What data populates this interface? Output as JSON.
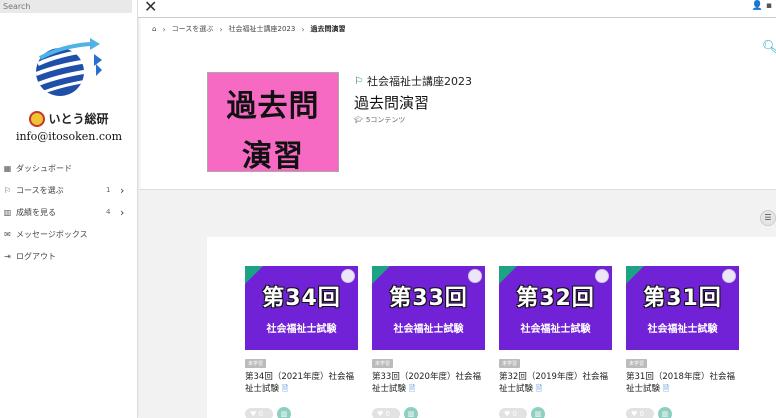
{
  "sidebar": {
    "search_placeholder": "Search",
    "brand_name": "いとう総研",
    "email": "info@itosoken.com",
    "items": [
      {
        "label": "ダッシュボード",
        "icon": "grid-icon",
        "glyph": "▦",
        "count": "",
        "chevron": ""
      },
      {
        "label": "コースを選ぶ",
        "icon": "flag-icon",
        "glyph": "⚐",
        "count": "1",
        "chevron": "›"
      },
      {
        "label": "成績を見る",
        "icon": "chart-icon",
        "glyph": "▥",
        "count": "4",
        "chevron": "›"
      },
      {
        "label": "メッセージボックス",
        "icon": "message-icon",
        "glyph": "✉",
        "count": "",
        "chevron": ""
      },
      {
        "label": "ログアウト",
        "icon": "logout-icon",
        "glyph": "⇥",
        "count": "",
        "chevron": ""
      }
    ]
  },
  "topbar": {
    "close_glyph": "✕",
    "user_glyph": "👤 ▪"
  },
  "breadcrumb": {
    "home_glyph": "⌂",
    "items": [
      "コースを選ぶ",
      "社会福祉士講座2023",
      "過去問演習"
    ]
  },
  "header": {
    "thumb_line1": "過去問",
    "thumb_line2": "演習",
    "course_name": "社会福祉士講座2023",
    "title": "過去問演習",
    "contents": "5コンテンツ"
  },
  "cards": [
    {
      "round": "第34回",
      "exam": "社会福祉士試験",
      "tag": "未学習",
      "title": "第34回（2021年度）社会福祉士試験",
      "likes": "0"
    },
    {
      "round": "第33回",
      "exam": "社会福祉士試験",
      "tag": "未学習",
      "title": "第33回（2020年度）社会福祉士試験",
      "likes": "0"
    },
    {
      "round": "第32回",
      "exam": "社会福祉士試験",
      "tag": "未学習",
      "title": "第32回（2019年度）社会福祉士試験",
      "likes": "0"
    },
    {
      "round": "第31回",
      "exam": "社会福祉士試験",
      "tag": "未学習",
      "title": "第31回（2018年度）社会福祉士試験",
      "likes": "0"
    }
  ],
  "colors": {
    "accent": "#13a8c4",
    "card_bg": "#7222d6",
    "ribbon": "#1ba384",
    "thumb_bg": "#f66ac4"
  }
}
